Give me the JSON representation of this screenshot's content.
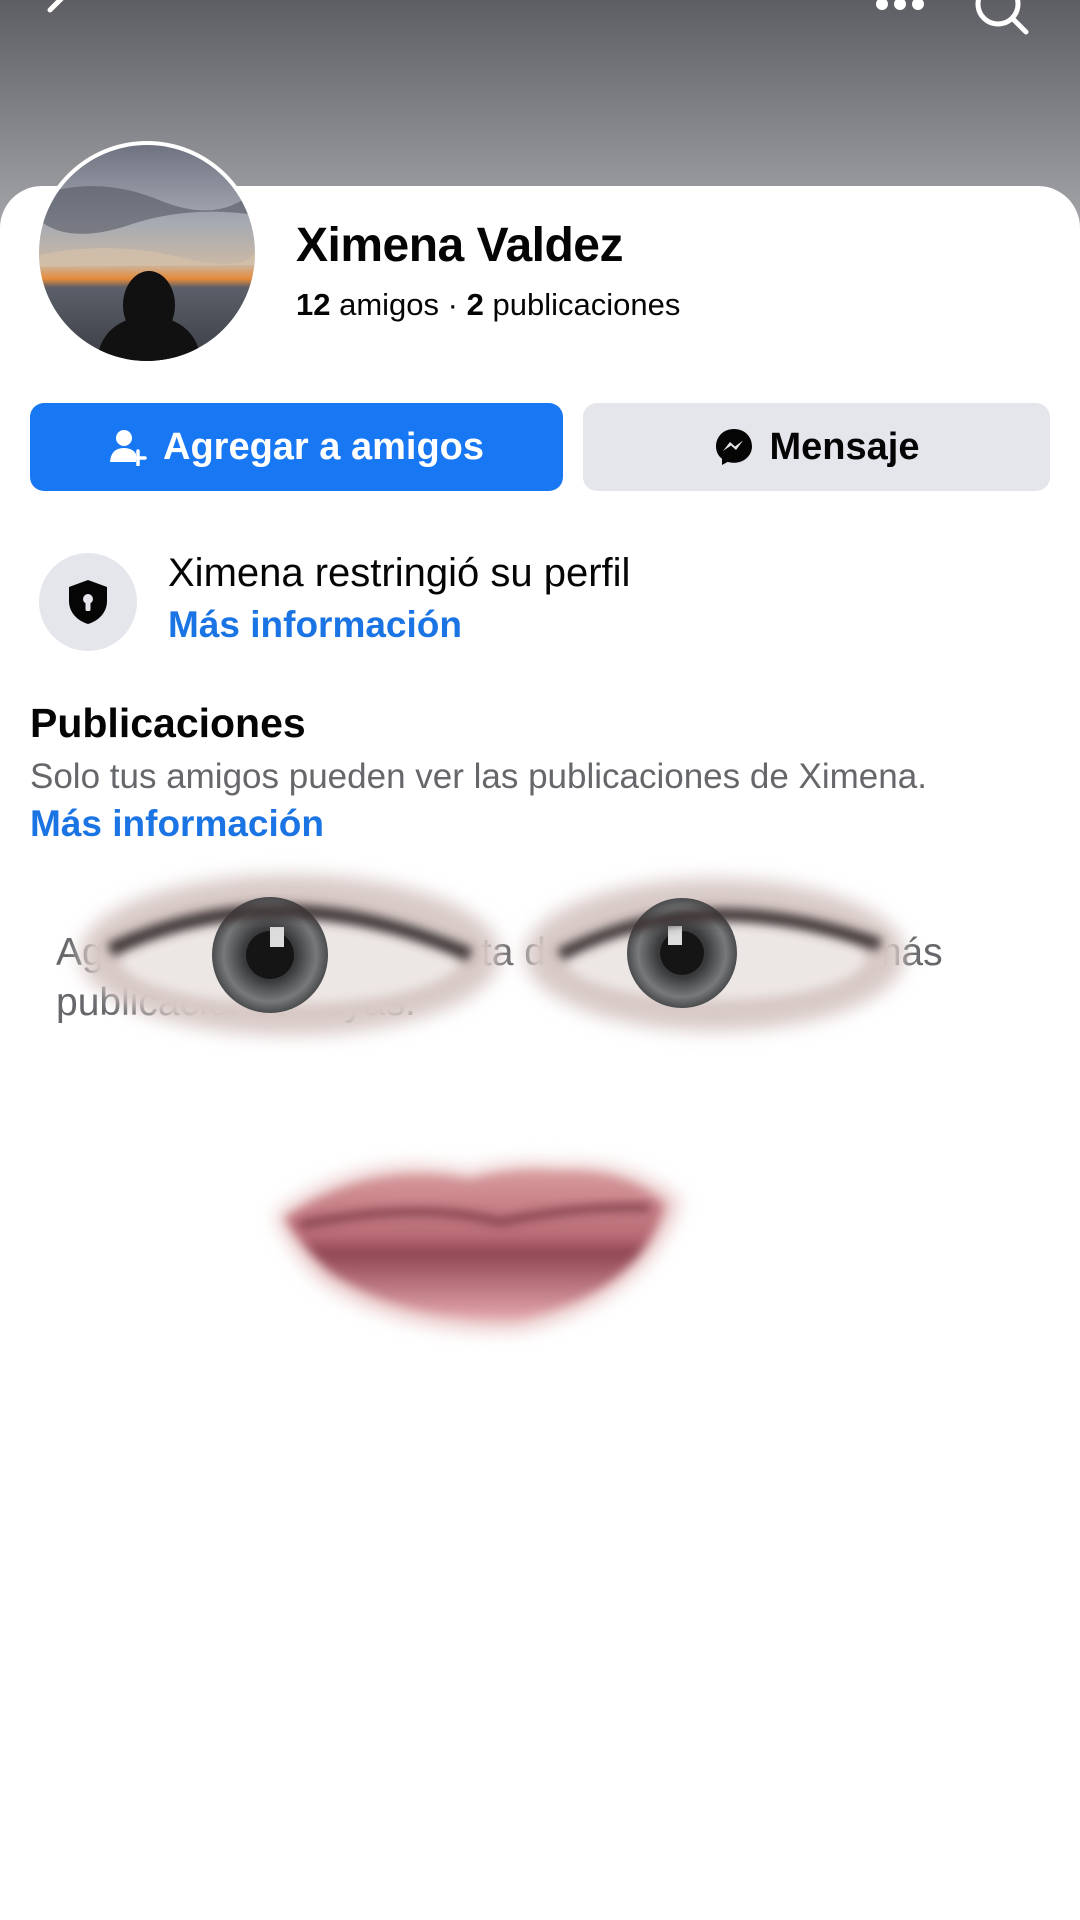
{
  "header": {
    "back_icon": "chevron-left-icon",
    "more_icon": "more-dots-icon",
    "search_icon": "search-icon"
  },
  "profile": {
    "name": "Ximena Valdez",
    "friends_count": "12",
    "friends_label": "amigos",
    "separator": "·",
    "posts_count": "2",
    "posts_label": "publicaciones"
  },
  "actions": {
    "add_friend_label": "Agregar a amigos",
    "add_friend_icon": "add-person-icon",
    "message_label": "Mensaje",
    "message_icon": "messenger-icon"
  },
  "restriction": {
    "icon": "shield-lock-icon",
    "text": "Ximena restringió su perfil",
    "link": "Más información"
  },
  "posts_section": {
    "title": "Publicaciones",
    "description": "Solo tus amigos pueden ver las publicaciones de Ximena.",
    "link": "Más información",
    "locked_text": "Agrega a Ximena a tu lista de amigos para ver más publicaciones suyas."
  },
  "colors": {
    "primary": "#1877f2",
    "link": "#1b74e4",
    "secondary_button": "#e4e6eb",
    "secondary_text": "#65676b"
  }
}
